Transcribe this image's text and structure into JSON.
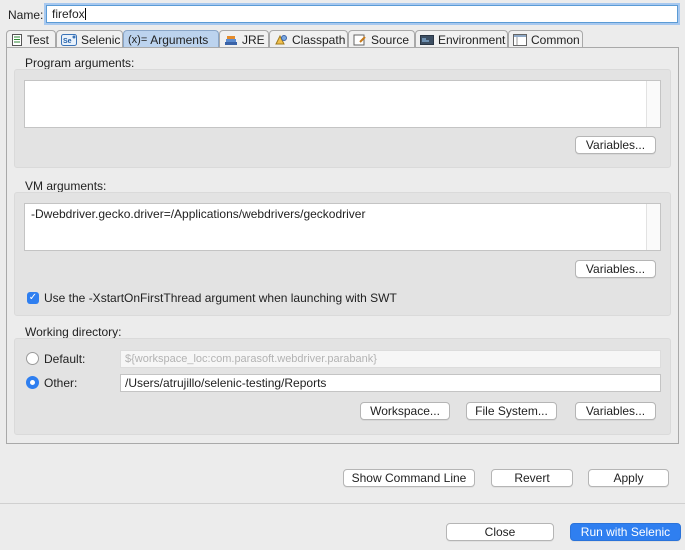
{
  "name": {
    "label": "Name:",
    "value": "firefox"
  },
  "tabs": [
    {
      "label": "Test",
      "icon": "test-icon",
      "active": false
    },
    {
      "label": "Selenic",
      "icon": "selenic-icon",
      "active": false
    },
    {
      "label": "Arguments",
      "icon": "arguments-icon",
      "active": true
    },
    {
      "label": "JRE",
      "icon": "jre-icon",
      "active": false
    },
    {
      "label": "Classpath",
      "icon": "classpath-icon",
      "active": false
    },
    {
      "label": "Source",
      "icon": "source-icon",
      "active": false
    },
    {
      "label": "Environment",
      "icon": "environment-icon",
      "active": false
    },
    {
      "label": "Common",
      "icon": "common-icon",
      "active": false
    }
  ],
  "arguments_icon_text": "(x)=",
  "program_args": {
    "label": "Program arguments:",
    "value": "",
    "variables_button": "Variables..."
  },
  "vm_args": {
    "label": "VM arguments:",
    "value": "-Dwebdriver.gecko.driver=/Applications/webdrivers/geckodriver",
    "variables_button": "Variables..."
  },
  "xstart": {
    "label": "Use the -XstartOnFirstThread argument when launching with SWT",
    "checked": true
  },
  "working_dir": {
    "label": "Working directory:",
    "default_label": "Default:",
    "default_value": "${workspace_loc:com.parasoft.webdriver.parabank}",
    "other_label": "Other:",
    "other_value": "/Users/atrujillo/selenic-testing/Reports",
    "selected": "other",
    "workspace_button": "Workspace...",
    "filesystem_button": "File System...",
    "variables_button": "Variables..."
  },
  "actions": {
    "show_command_line": "Show Command Line",
    "revert": "Revert",
    "apply": "Apply",
    "close": "Close",
    "run": "Run with Selenic"
  },
  "colors": {
    "accent": "#2f7ff0",
    "active_tab": "#bcd3ee"
  }
}
